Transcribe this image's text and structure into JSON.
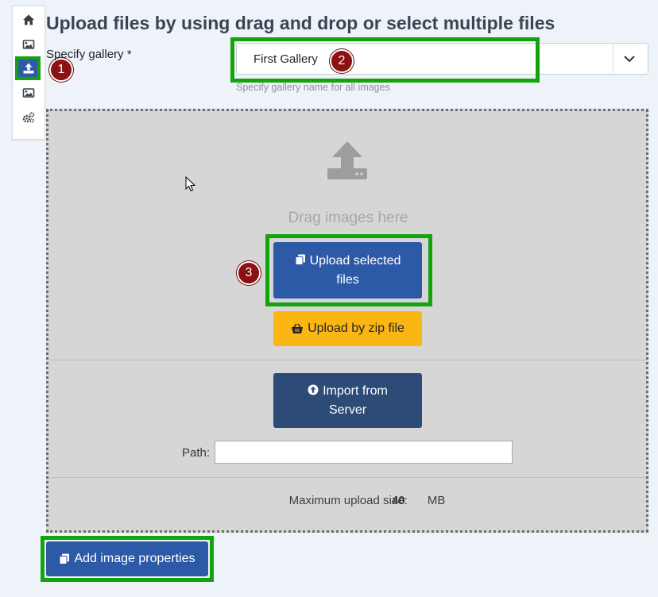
{
  "toolbar": {
    "items": [
      {
        "icon": "home-icon"
      },
      {
        "icon": "image-icon"
      },
      {
        "icon": "upload-icon",
        "active": true
      },
      {
        "icon": "image-icon"
      },
      {
        "icon": "cogs-icon"
      }
    ]
  },
  "page": {
    "title": "Upload files by using drag and drop or select multiple files"
  },
  "gallery": {
    "label": "Specify gallery *",
    "selected": "First Gallery",
    "hint": "Specify gallery name for all images"
  },
  "dropzone": {
    "drag_text": "Drag images here",
    "upload_selected_label": "Upload selected files",
    "upload_zip_label": "Upload by zip file",
    "import_server_label": "Import from Server",
    "path_label": "Path:",
    "path_value": "",
    "max_size_prefix": "Maximum upload size:",
    "max_size_value": "40",
    "max_size_unit": "MB"
  },
  "footer": {
    "add_properties_label": "Add image properties"
  },
  "annotations": {
    "badge_1": "1",
    "badge_2": "2",
    "badge_3": "3"
  },
  "colors": {
    "highlight": "#13a30d",
    "badge": "#8c1111",
    "primary": "#2c5aa7",
    "warning": "#fbb614",
    "navy": "#2c4b76"
  }
}
